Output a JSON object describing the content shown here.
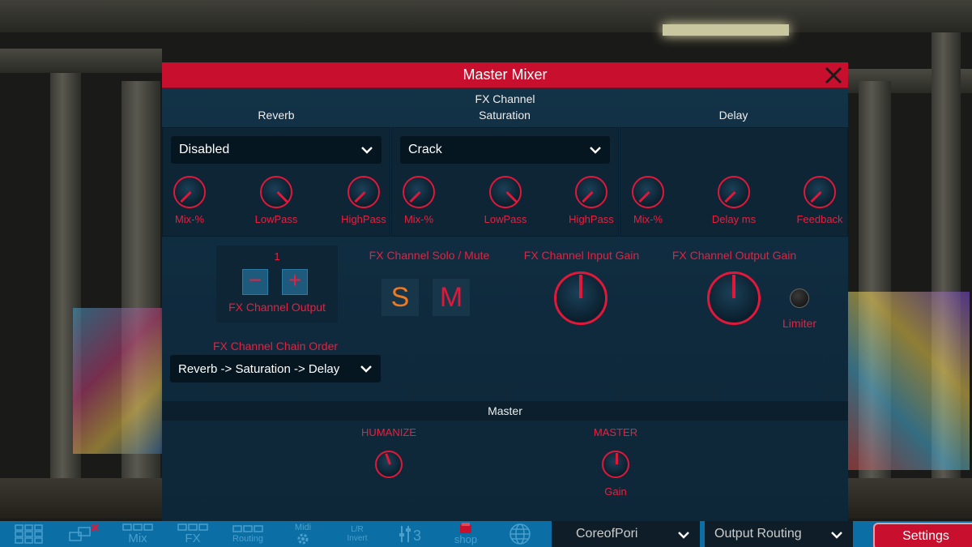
{
  "window": {
    "title": "Master Mixer"
  },
  "fx_channel": {
    "heading": "FX Channel",
    "reverb": {
      "title": "Reverb",
      "preset": "Disabled",
      "knobs": [
        "Mix-%",
        "LowPass",
        "HighPass"
      ]
    },
    "saturation": {
      "title": "Saturation",
      "preset": "Crack",
      "knobs": [
        "Mix-%",
        "LowPass",
        "HighPass"
      ]
    },
    "delay": {
      "title": "Delay",
      "knobs": [
        "Mix-%",
        "Delay ms",
        "Feedback"
      ]
    },
    "output": {
      "value": "1",
      "minus": "−",
      "plus": "+",
      "label": "FX Channel Output"
    },
    "solo_mute": {
      "label": "FX Channel Solo / Mute",
      "solo": "S",
      "mute": "M"
    },
    "input_gain": {
      "label": "FX Channel Input Gain"
    },
    "output_gain": {
      "label": "FX Channel Output Gain"
    },
    "limiter": {
      "label": "Limiter"
    },
    "chain_order": {
      "label": "FX Channel Chain Order",
      "value": "Reverb -> Saturation -> Delay"
    }
  },
  "master": {
    "heading": "Master",
    "humanize": {
      "label": "HUMANIZE"
    },
    "master": {
      "label": "MASTER",
      "sublabel": "Gain"
    }
  },
  "taskbar": {
    "mix": "Mix",
    "fx": "FX",
    "routing": "Routing",
    "midi": "Midi",
    "lr_invert": "L/R Invert",
    "shop": "shop",
    "kit_select": "CoreofPori",
    "output_select": "Output Routing",
    "settings": "Settings"
  },
  "colors": {
    "accent": "#c8102e",
    "knob_red": "#e0183a",
    "solo": "#f07a20",
    "panel": "#133348",
    "taskbar": "#0b6fa6"
  }
}
